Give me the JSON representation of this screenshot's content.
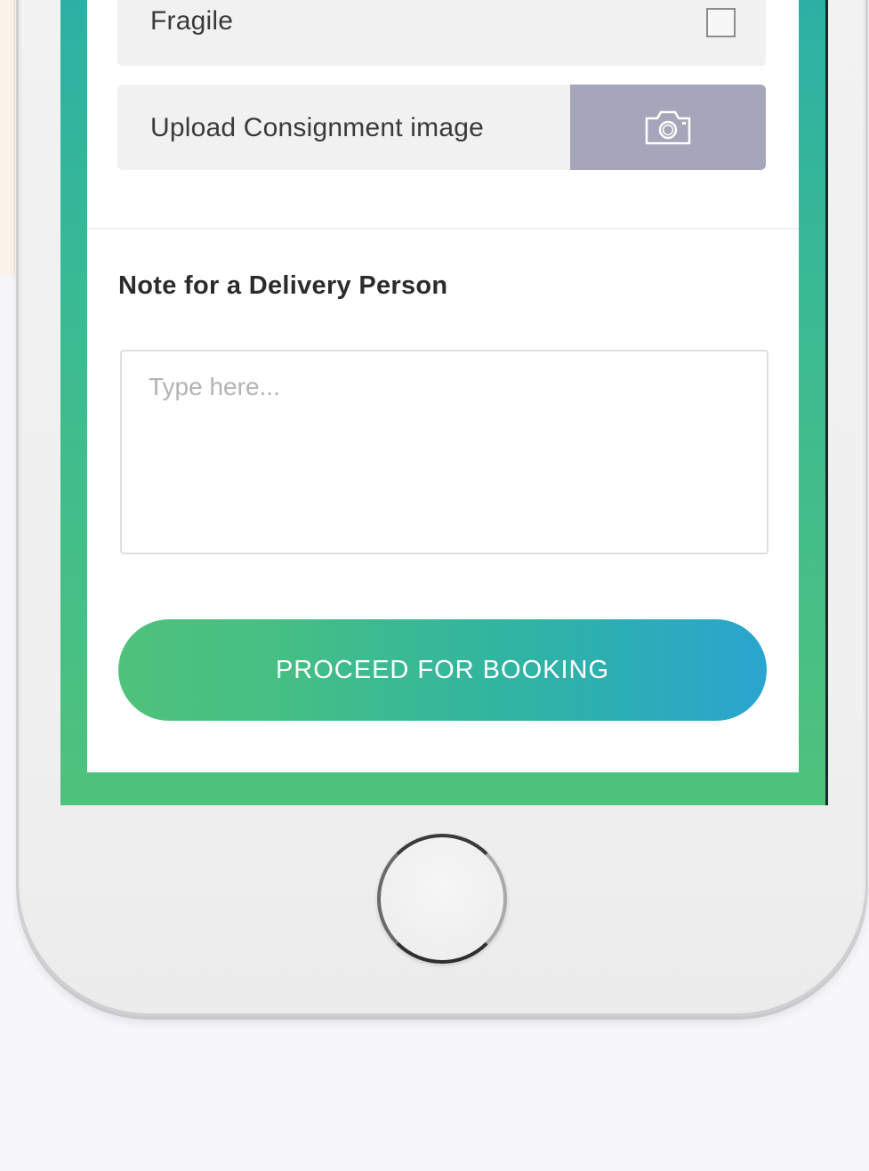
{
  "form": {
    "fragile_label": "Fragile",
    "fragile_checked": false,
    "upload_label": "Upload Consignment image",
    "camera_icon": "camera-icon"
  },
  "note": {
    "title": "Note for a Delivery Person",
    "placeholder": "Type here...",
    "value": ""
  },
  "actions": {
    "proceed_label": "PROCEED FOR BOOKING"
  },
  "colors": {
    "green": "#4fc27c",
    "teal": "#2eb3a6",
    "blue": "#2aa5d0",
    "camera_button": "#a6a6ba"
  }
}
